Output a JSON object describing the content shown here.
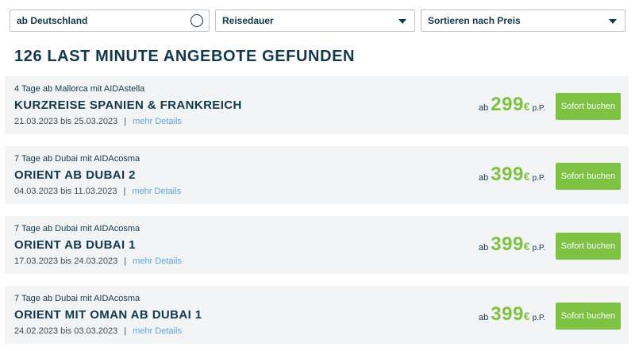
{
  "filters": {
    "departure": "ab Deutschland",
    "duration": "Reisedauer",
    "sort": "Sortieren nach Preis"
  },
  "heading": "126 LAST MINUTE ANGEBOTE GEFUNDEN",
  "offers": [
    {
      "subtitle": "4 Tage ab Mallorca mit AIDAstella",
      "title": "KURZREISE SPANIEN & FRANKREICH",
      "dates": "21.03.2023 bis 25.03.2023",
      "price": "299"
    },
    {
      "subtitle": "7 Tage ab Dubai mit AIDAcosma",
      "title": "ORIENT AB DUBAI 2",
      "dates": "04.03.2023 bis 11.03.2023",
      "price": "399"
    },
    {
      "subtitle": "7 Tage ab Dubai mit AIDAcosma",
      "title": "ORIENT AB DUBAI 1",
      "dates": "17.03.2023 bis 24.03.2023",
      "price": "399"
    },
    {
      "subtitle": "7 Tage ab Dubai mit AIDAcosma",
      "title": "ORIENT MIT OMAN AB DUBAI 1",
      "dates": "24.02.2023 bis 03.03.2023",
      "price": "399"
    }
  ],
  "labels": {
    "separator": "|",
    "details": "mehr Details",
    "price_prefix": "ab",
    "currency": "€",
    "per_person": "p.P.",
    "book": "Sofort buchen"
  },
  "icons": {
    "departure": "circle-icon",
    "dropdown": "chevron-down-icon"
  },
  "colors": {
    "primary_text": "#12384f",
    "accent_green": "#7dc242",
    "link_blue": "#5fa6d6",
    "card_bg": "#f3f4f5"
  }
}
